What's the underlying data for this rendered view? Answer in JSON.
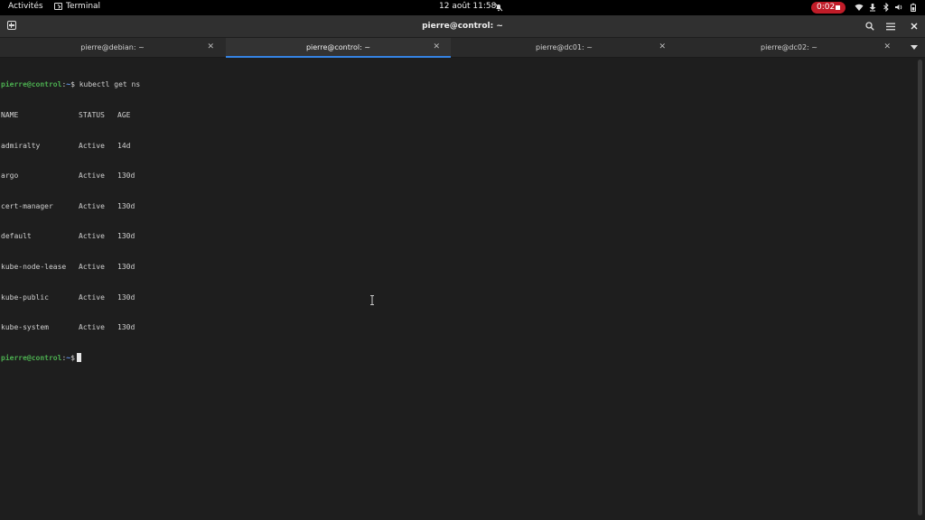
{
  "topbar": {
    "activities": "Activités",
    "app_name": "Terminal",
    "datetime": "12 août  11:58",
    "recording_time": "0:02"
  },
  "window": {
    "title": "pierre@control: ~"
  },
  "tabs": [
    {
      "label": "pierre@debian: ~",
      "active": false
    },
    {
      "label": "pierre@control: ~",
      "active": true
    },
    {
      "label": "pierre@dc01: ~",
      "active": false
    },
    {
      "label": "pierre@dc02: ~",
      "active": false
    }
  ],
  "terminal": {
    "prompt_user": "pierre@control",
    "prompt_path": "~",
    "command": "kubectl get ns",
    "headers": [
      "NAME",
      "STATUS",
      "AGE"
    ],
    "rows": [
      [
        "admiralty",
        "Active",
        "14d"
      ],
      [
        "argo",
        "Active",
        "130d"
      ],
      [
        "cert-manager",
        "Active",
        "130d"
      ],
      [
        "default",
        "Active",
        "130d"
      ],
      [
        "kube-node-lease",
        "Active",
        "130d"
      ],
      [
        "kube-public",
        "Active",
        "130d"
      ],
      [
        "kube-system",
        "Active",
        "130d"
      ]
    ]
  },
  "colors": {
    "accent": "#3584e4",
    "prompt": "#4caf50",
    "record": "#c01c28"
  }
}
